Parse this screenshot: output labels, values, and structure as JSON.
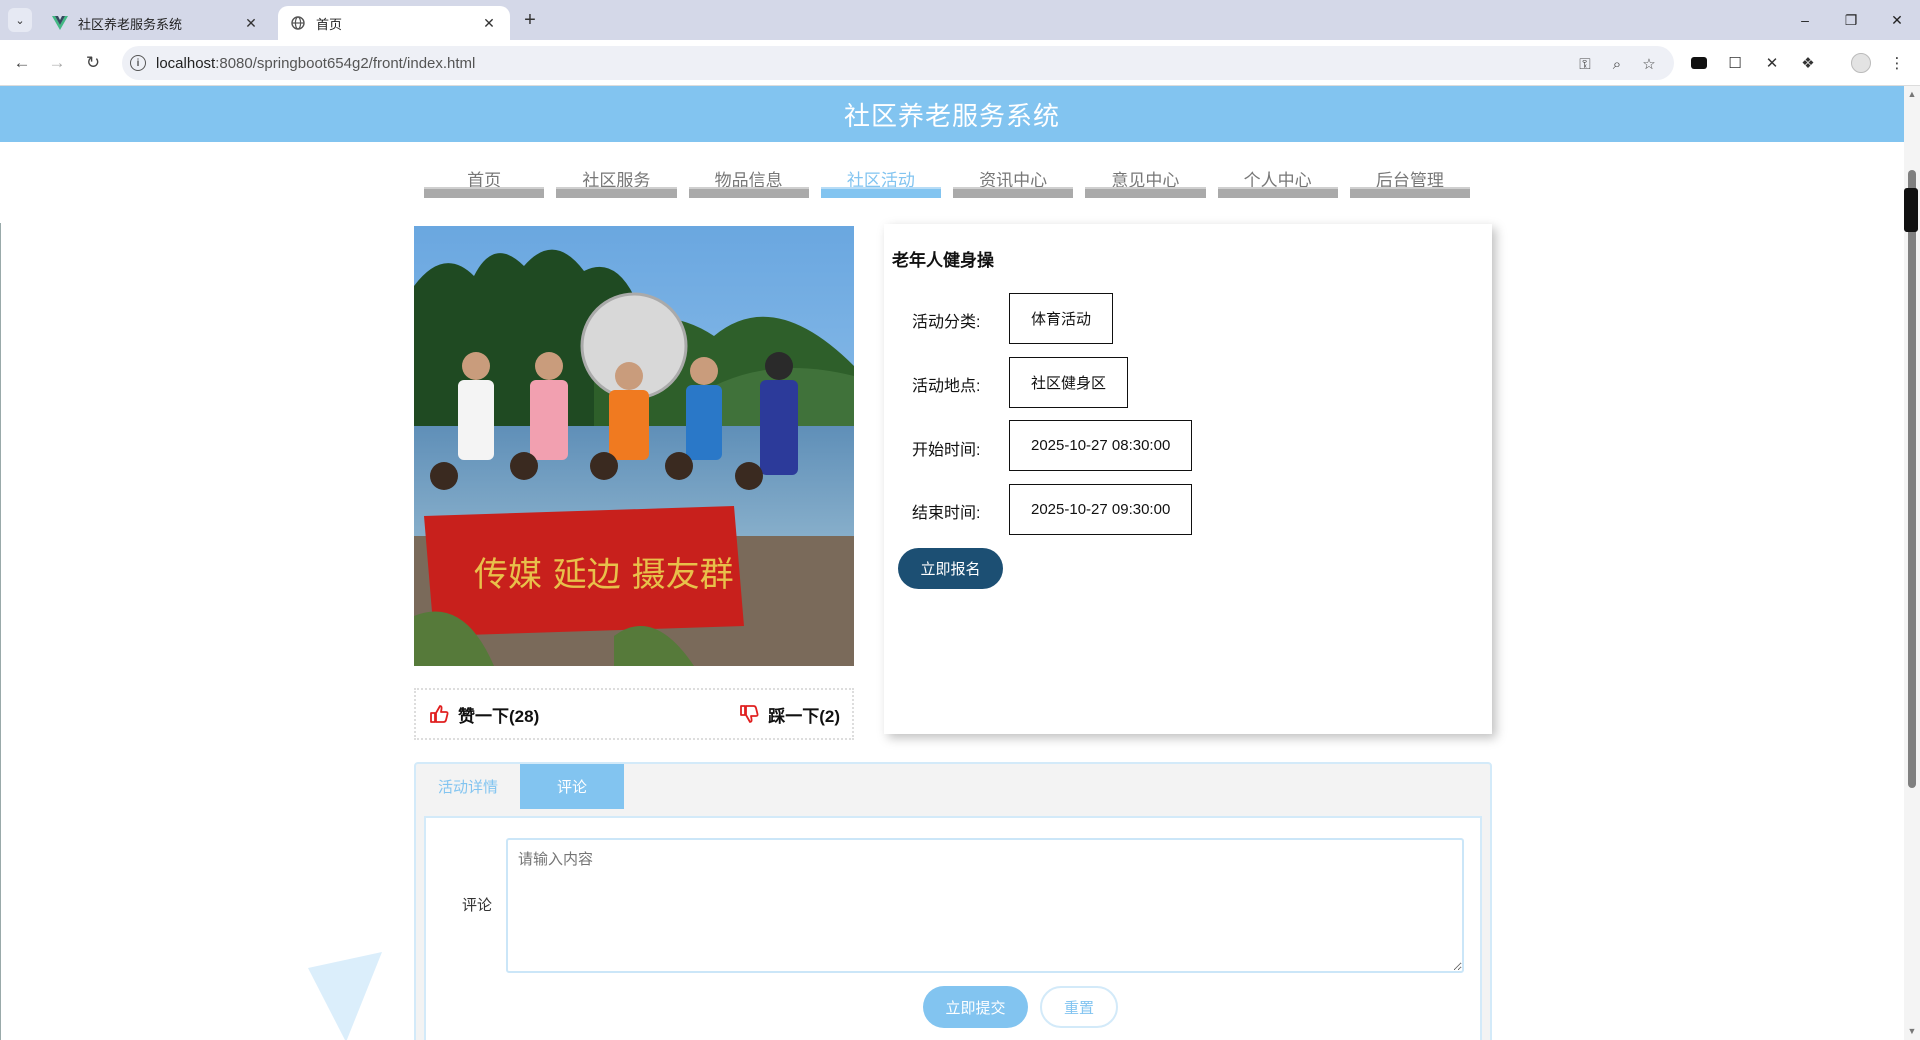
{
  "browser": {
    "tabs": [
      {
        "title": "社区养老服务系统",
        "active": false
      },
      {
        "title": "首页",
        "active": true
      }
    ],
    "url_host": "localhost",
    "url_path": ":8080/springboot654g2/front/index.html"
  },
  "site": {
    "title": "社区养老服务系统"
  },
  "nav": {
    "items": [
      "首页",
      "社区服务",
      "物品信息",
      "社区活动",
      "资讯中心",
      "意见中心",
      "个人中心",
      "后台管理"
    ],
    "active": "社区活动"
  },
  "activity": {
    "title": "老年人健身操",
    "fields": [
      {
        "label": "活动分类:",
        "value": "体育活动"
      },
      {
        "label": "活动地点:",
        "value": "社区健身区"
      },
      {
        "label": "开始时间:",
        "value": "2025-10-27 08:30:00"
      },
      {
        "label": "结束时间:",
        "value": "2025-10-27 09:30:00"
      }
    ],
    "signup_label": "立即报名",
    "like_label": "赞一下(28)",
    "dislike_label": "踩一下(2)",
    "banner_text": "传媒 延边 摄友群"
  },
  "detail_tabs": {
    "items": [
      "活动详情",
      "评论"
    ],
    "active": "评论"
  },
  "comment": {
    "label": "评论",
    "placeholder": "请输入内容",
    "submit_label": "立即提交",
    "reset_label": "重置"
  },
  "colors": {
    "accent": "#82c4f0",
    "dark_button": "#1c4f73",
    "nav_inactive": "#aaaaaa"
  }
}
